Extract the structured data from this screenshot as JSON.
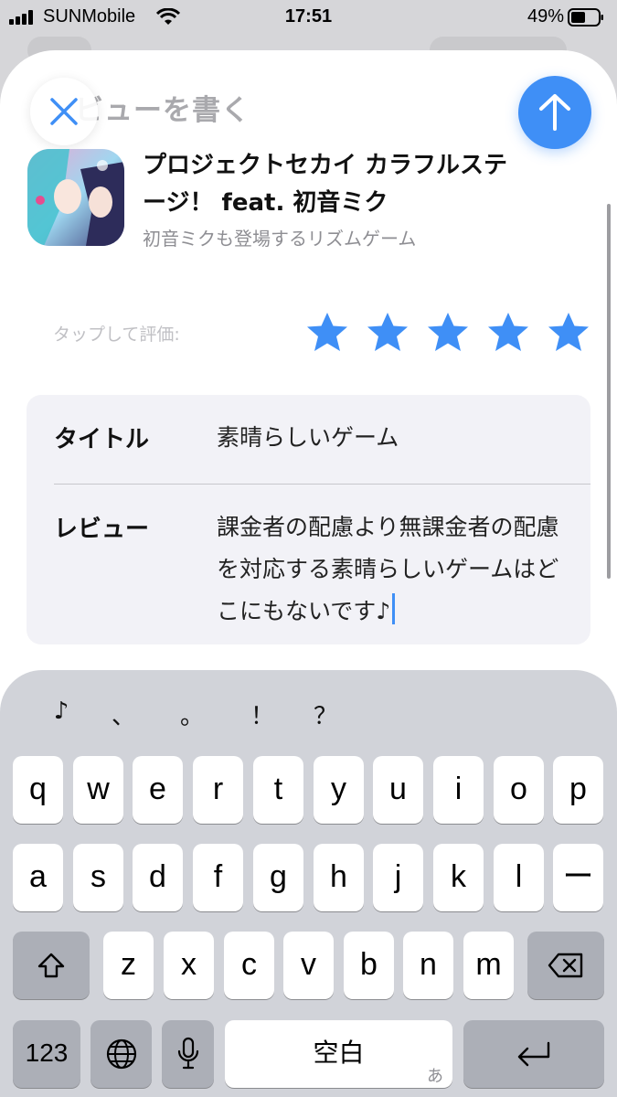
{
  "status_bar": {
    "carrier": "SUNMobile",
    "time": "17:51",
    "battery_pct": "49%"
  },
  "sheet": {
    "title": "ビューを書く"
  },
  "app": {
    "name": "プロジェクトセカイ カラフルステージ！ feat. 初音ミク",
    "subtitle": "初音ミクも登場するリズムゲーム"
  },
  "rating": {
    "label": "タップして評価:",
    "stars": 5,
    "max": 5,
    "color": "#3f8ff6"
  },
  "form": {
    "title_label": "タイトル",
    "title_value": "素晴らしいゲーム",
    "review_label": "レビュー",
    "review_value": "課金者の配慮より無課金者の配慮を対応する素晴らしいゲームはどこにもないです♪"
  },
  "keyboard": {
    "suggestions": [
      "♪",
      "、",
      "。",
      "！",
      "？"
    ],
    "row1": [
      "q",
      "w",
      "e",
      "r",
      "t",
      "y",
      "u",
      "i",
      "o",
      "p"
    ],
    "row2": [
      "a",
      "s",
      "d",
      "f",
      "g",
      "h",
      "j",
      "k",
      "l",
      "ー"
    ],
    "row3": [
      "z",
      "x",
      "c",
      "v",
      "b",
      "n",
      "m"
    ],
    "numbers_key": "123",
    "space_key": "空白",
    "space_sub": "あ",
    "icons": {
      "shift": "shift-icon",
      "delete": "delete-icon",
      "globe": "globe-icon",
      "mic": "microphone-icon",
      "return": "return-icon"
    }
  },
  "colors": {
    "accent": "#3f8ff6",
    "keyboard_bg": "#d1d3d9",
    "form_bg": "#f2f2f7"
  }
}
